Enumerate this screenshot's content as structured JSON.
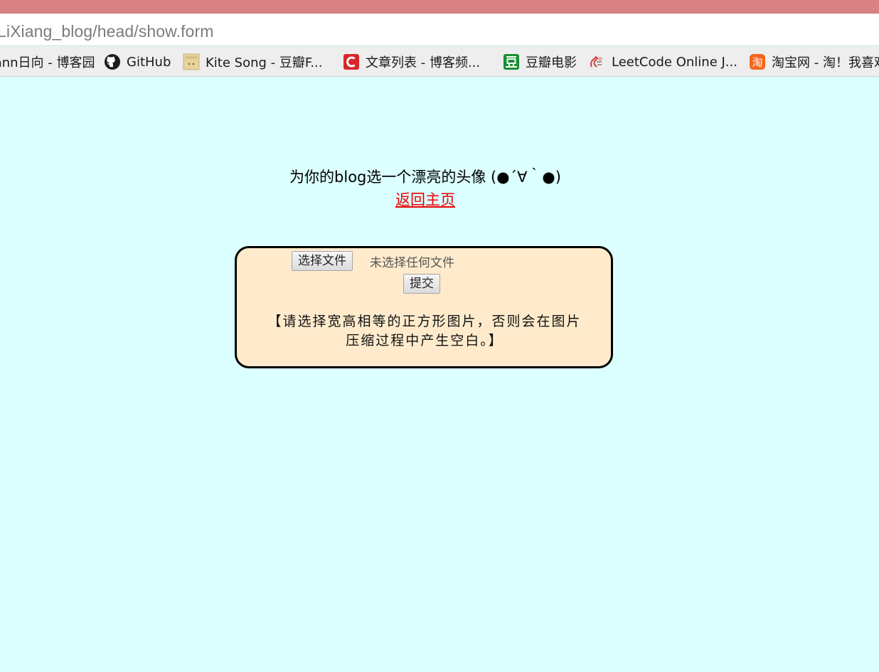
{
  "browser": {
    "url": "LiXiang_blog/head/show.form",
    "bookmarks": [
      {
        "label": "Fann日向 - 博客园",
        "icon": "none"
      },
      {
        "label": "GitHub",
        "icon": "github-icon"
      },
      {
        "label": "Kite Song - 豆瓣F...",
        "icon": "douban-avatar-icon"
      },
      {
        "label": "文章列表 - 博客频...",
        "icon": "csdn-icon"
      },
      {
        "label": "豆瓣电影",
        "icon": "douban-icon"
      },
      {
        "label": "LeetCode Online J...",
        "icon": "leetcode-icon"
      },
      {
        "label": "淘宝网 - 淘！我喜欢",
        "icon": "taobao-icon"
      }
    ]
  },
  "page": {
    "heading": "为你的blog选一个漂亮的头像 (●´∀｀●)",
    "back_link": "返回主页",
    "upload": {
      "choose_file_label": "选择文件",
      "no_file_text": "未选择任何文件",
      "submit_label": "提交",
      "notice_line1": "【请选择宽高相等的正方形图片，否则会在图片",
      "notice_line2": "压缩过程中产生空白。】"
    }
  },
  "colors": {
    "titlebar": "#d98283",
    "page_background": "#dcffff",
    "upload_box_background": "#ffebcc",
    "link": "#ee0000"
  }
}
